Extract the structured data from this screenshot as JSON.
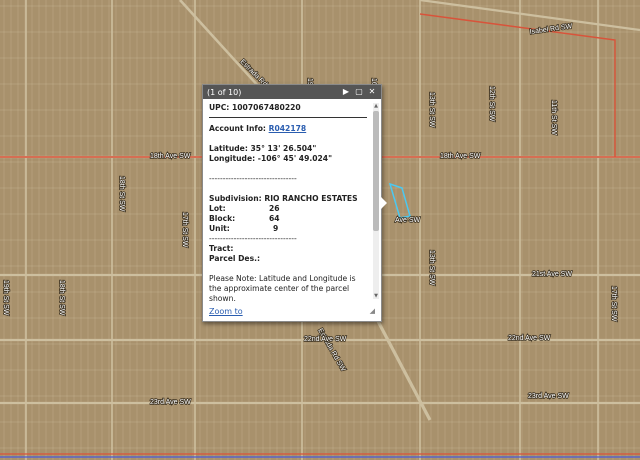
{
  "map": {
    "colors": {
      "ground": "#a8916c",
      "road": "#cdbf9f",
      "county_line": "#d9533a",
      "parcel_outline": "#4cc8f0",
      "blue_line": "#4a5bd8"
    },
    "road_labels": [
      "Isabel Rd SW",
      "18th Ave SW",
      "18th Ave SW",
      "Estrada Rd SW",
      "19th St SW",
      "18th St SW",
      "17th St SW",
      "12th St SW",
      "13th St SW",
      "11th St SW",
      "16th St SW",
      "18th St SW",
      "17th St SW",
      "21st Ave SW",
      "Estrada Rd SW",
      "Ave SW",
      "13th St SW",
      "22nd Ave SW",
      "22nd Ave SW",
      "23rd Ave SW",
      "23rd Ave SW",
      "19th St SW"
    ]
  },
  "popup": {
    "counter": "(1 of 10)",
    "upc": "UPC: 1007067480220",
    "account_label": "Account Info:",
    "account_link": "R042178",
    "latitude": "Latitude: 35° 13' 26.504\"",
    "longitude": "Longitude: -106° 45' 49.024\"",
    "dashes": "--------------------------------",
    "subdivision_label": "Subdivision:",
    "subdivision_value": "RIO RANCHO ESTATES",
    "lot_label": "Lot:",
    "lot_value": "26",
    "block_label": "Block:",
    "block_value": "64",
    "unit_label": "Unit:",
    "unit_value": "9",
    "tract_label": "Tract:",
    "parcel_label": "Parcel Des.:",
    "note": "Please Note: Latitude and Longitude is the approximate center of the parcel shown.",
    "zoom_link": "Zoom to"
  }
}
